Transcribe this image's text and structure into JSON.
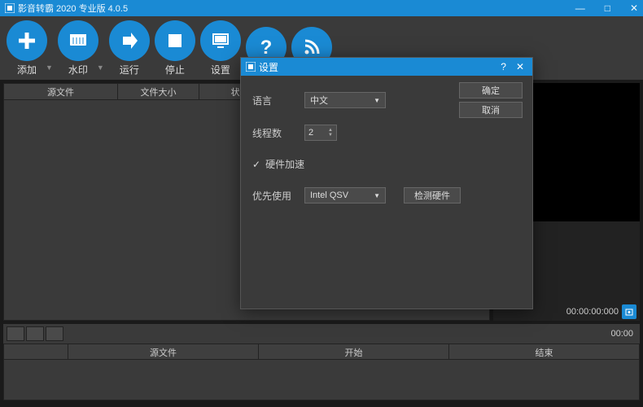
{
  "titlebar": {
    "title": "影音转霸 2020 专业版 4.0.5"
  },
  "toolbar": {
    "add": "添加",
    "watermark": "水印",
    "run": "运行",
    "stop": "停止",
    "settings": "设置",
    "help": "",
    "rss": ""
  },
  "file_list": {
    "cols": {
      "source": "源文件",
      "size": "文件大小",
      "status": "状态"
    }
  },
  "preview": {
    "timecode": "00:00:00:000"
  },
  "bottom": {
    "time": "00:00",
    "cols": {
      "blank": "",
      "source": "源文件",
      "start": "开始",
      "end": "结束"
    }
  },
  "dialog": {
    "title": "设置",
    "ok": "确定",
    "cancel": "取消",
    "language_label": "语言",
    "language_value": "中文",
    "threads_label": "线程数",
    "threads_value": "2",
    "hwaccel_label": "硬件加速",
    "prefer_label": "优先使用",
    "prefer_value": "Intel QSV",
    "detect": "检测硬件"
  }
}
